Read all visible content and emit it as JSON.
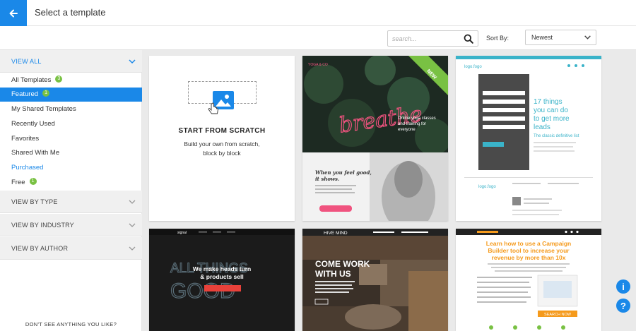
{
  "header": {
    "title": "Select a template"
  },
  "toolbar": {
    "search_placeholder": "search...",
    "sort_label": "Sort By:",
    "sort_value": "Newest"
  },
  "sidebar": {
    "view_all": "VIEW ALL",
    "items": [
      {
        "label": "All Templates",
        "badge": "3"
      },
      {
        "label": "Featured",
        "badge": "1"
      },
      {
        "label": "My Shared Templates"
      },
      {
        "label": "Recently Used"
      },
      {
        "label": "Favorites"
      },
      {
        "label": "Shared With Me"
      },
      {
        "label": "Purchased"
      },
      {
        "label": "Free",
        "badge": "1"
      }
    ],
    "sections": [
      "VIEW BY TYPE",
      "VIEW BY INDUSTRY",
      "VIEW BY AUTHOR"
    ],
    "footer": "DON'T SEE ANYTHING YOU LIKE?"
  },
  "scratch": {
    "title": "START FROM SCRATCH",
    "subtitle_line1": "Build your own from scratch,",
    "subtitle_line2": "block by block"
  },
  "templates": {
    "yoga": {
      "brand": "YOGA & CO",
      "ribbon": "NEW",
      "neon": "breathe",
      "blurb": "Online yoga classes and training for everyone",
      "quote_line1": "When you feel good,",
      "quote_line2": "it shows."
    },
    "webinar": {
      "logo": "logo.fogo",
      "heading_line1": "17 things",
      "heading_line2": "you can do",
      "heading_line3": "to get more",
      "heading_line4": "leads",
      "sub": "The classic definitive list"
    },
    "signal": {
      "logo": "signal",
      "bg_word1": "ALL THINGS",
      "bg_word2": "GOOD",
      "headline_line1": "We make heads turn",
      "headline_line2": "& products sell"
    },
    "hive": {
      "brand": "HIVE MIND",
      "headline_line1": "COME WORK",
      "headline_line2": "WITH US"
    },
    "campaign": {
      "headline_line1": "Learn how to use a Campaign",
      "headline_line2": "Builder tool to increase your",
      "headline_line3": "revenue by more than 10x",
      "cta": "SEARCH NOW"
    }
  },
  "colors": {
    "accent": "#1a88e8",
    "badge": "#79c143",
    "neon": "#f0537f",
    "campaign_orange": "#f59a1c",
    "webinar_teal": "#3ab3c9"
  }
}
